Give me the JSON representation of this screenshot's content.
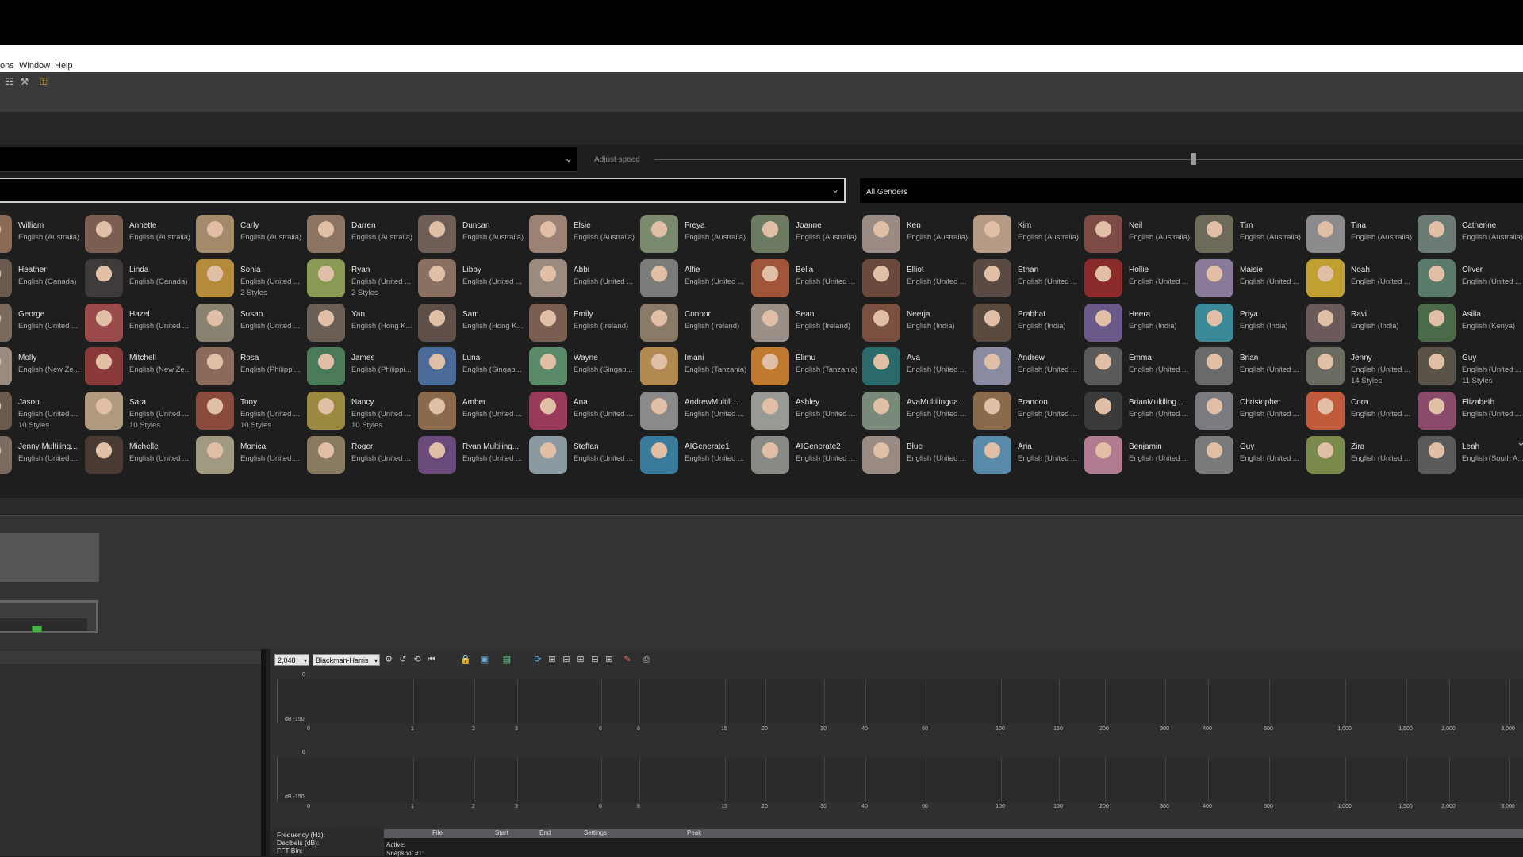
{
  "menu": {
    "items": [
      "ons",
      "Window",
      "Help"
    ]
  },
  "controls": {
    "speed_label": "Adjust speed",
    "speed_fraction": 0.62,
    "gender_filter": "All Genders"
  },
  "voices": [
    [
      {
        "name": "William",
        "sub": "English (Australia)",
        "color": "#8a6a55"
      },
      {
        "name": "Annette",
        "sub": "English (Australia)",
        "color": "#7b5d52"
      },
      {
        "name": "Carly",
        "sub": "English (Australia)",
        "color": "#a38a6a"
      },
      {
        "name": "Darren",
        "sub": "English (Australia)",
        "color": "#8b7462"
      },
      {
        "name": "Duncan",
        "sub": "English (Australia)",
        "color": "#6f5e55"
      },
      {
        "name": "Elsie",
        "sub": "English (Australia)",
        "color": "#9b8274"
      },
      {
        "name": "Freya",
        "sub": "English (Australia)",
        "color": "#7a8a6e"
      },
      {
        "name": "Joanne",
        "sub": "English (Australia)",
        "color": "#6d7a62"
      },
      {
        "name": "Ken",
        "sub": "English (Australia)",
        "color": "#9a8c85"
      },
      {
        "name": "Kim",
        "sub": "English (Australia)",
        "color": "#b59a86"
      },
      {
        "name": "Neil",
        "sub": "English (Australia)",
        "color": "#7c4b45"
      },
      {
        "name": "Tim",
        "sub": "English (Australia)",
        "color": "#6e6a5a"
      },
      {
        "name": "Tina",
        "sub": "English (Australia)",
        "color": "#8c8a8c"
      },
      {
        "name": "Catherine",
        "sub": "English (Australia)",
        "color": "#6b7a72"
      }
    ],
    [
      {
        "name": "Heather",
        "sub": "English (Canada)",
        "color": "#6a5a50"
      },
      {
        "name": "Linda",
        "sub": "English (Canada)",
        "color": "#3e3a3a"
      },
      {
        "name": "Sonia",
        "sub": "English (United ...",
        "styles": "2 Styles",
        "color": "#b58a3a"
      },
      {
        "name": "Ryan",
        "sub": "English (United ...",
        "styles": "2 Styles",
        "color": "#8a9a55"
      },
      {
        "name": "Libby",
        "sub": "English (United ...",
        "color": "#8a7060"
      },
      {
        "name": "Abbi",
        "sub": "English (United ...",
        "color": "#9a8a80"
      },
      {
        "name": "Alfie",
        "sub": "English (United ...",
        "color": "#7a7c7a"
      },
      {
        "name": "Bella",
        "sub": "English (United ...",
        "color": "#a0553a"
      },
      {
        "name": "Elliot",
        "sub": "English (United ...",
        "color": "#6b4a3e"
      },
      {
        "name": "Ethan",
        "sub": "English (United ...",
        "color": "#5a4a44"
      },
      {
        "name": "Hollie",
        "sub": "English (United ...",
        "color": "#8a2a2a"
      },
      {
        "name": "Maisie",
        "sub": "English (United ...",
        "color": "#8a7a9a"
      },
      {
        "name": "Noah",
        "sub": "English (United ...",
        "color": "#c0a030"
      },
      {
        "name": "Oliver",
        "sub": "English (United ...",
        "color": "#5a7a6a"
      }
    ],
    [
      {
        "name": "George",
        "sub": "English (United ...",
        "color": "#7a6a5e"
      },
      {
        "name": "Hazel",
        "sub": "English (United ...",
        "color": "#9a4a4a"
      },
      {
        "name": "Susan",
        "sub": "English (United ...",
        "color": "#8a8270"
      },
      {
        "name": "Yan",
        "sub": "English (Hong K...",
        "color": "#6a5e55"
      },
      {
        "name": "Sam",
        "sub": "English (Hong K...",
        "color": "#5e5048"
      },
      {
        "name": "Emily",
        "sub": "English (Ireland)",
        "color": "#7a5e52"
      },
      {
        "name": "Connor",
        "sub": "English (Ireland)",
        "color": "#8a7a68"
      },
      {
        "name": "Sean",
        "sub": "English (Ireland)",
        "color": "#9a9088"
      },
      {
        "name": "Neerja",
        "sub": "English (India)",
        "color": "#7a5040"
      },
      {
        "name": "Prabhat",
        "sub": "English (India)",
        "color": "#5a4a3e"
      },
      {
        "name": "Heera",
        "sub": "English (India)",
        "color": "#6a5a8a"
      },
      {
        "name": "Priya",
        "sub": "English (India)",
        "color": "#3a8a9a"
      },
      {
        "name": "Ravi",
        "sub": "English (India)",
        "color": "#6a5a5a"
      },
      {
        "name": "Asilia",
        "sub": "English (Kenya)",
        "color": "#4a6a4a"
      }
    ],
    [
      {
        "name": "Molly",
        "sub": "English (New Ze...",
        "color": "#9a8a80"
      },
      {
        "name": "Mitchell",
        "sub": "English (New Ze...",
        "color": "#8a3a3a"
      },
      {
        "name": "Rosa",
        "sub": "English (Philippi...",
        "color": "#8a6a5a"
      },
      {
        "name": "James",
        "sub": "English (Philippi...",
        "color": "#4a7a5a"
      },
      {
        "name": "Luna",
        "sub": "English (Singap...",
        "color": "#4a6a9a"
      },
      {
        "name": "Wayne",
        "sub": "English (Singap...",
        "color": "#5a8a6a"
      },
      {
        "name": "Imani",
        "sub": "English (Tanzania)",
        "color": "#b08a50"
      },
      {
        "name": "Elimu",
        "sub": "English (Tanzania)",
        "color": "#c07a30"
      },
      {
        "name": "Ava",
        "sub": "English (United ...",
        "color": "#2a6a6a"
      },
      {
        "name": "Andrew",
        "sub": "English (United ...",
        "color": "#8a8aa0"
      },
      {
        "name": "Emma",
        "sub": "English (United ...",
        "color": "#5a5a5a"
      },
      {
        "name": "Brian",
        "sub": "English (United ...",
        "color": "#6a6a6a"
      },
      {
        "name": "Jenny",
        "sub": "English (United ...",
        "styles": "14 Styles",
        "color": "#6a6a60"
      },
      {
        "name": "Guy",
        "sub": "English (United ...",
        "styles": "11 Styles",
        "color": "#5a5448"
      }
    ],
    [
      {
        "name": "Jason",
        "sub": "English (United ...",
        "styles": "10 Styles",
        "color": "#6a5a4e"
      },
      {
        "name": "Sara",
        "sub": "English (United ...",
        "styles": "10 Styles",
        "color": "#b09a80"
      },
      {
        "name": "Tony",
        "sub": "English (United ...",
        "styles": "10 Styles",
        "color": "#8a4a3e"
      },
      {
        "name": "Nancy",
        "sub": "English (United ...",
        "styles": "10 Styles",
        "color": "#9a8a40"
      },
      {
        "name": "Amber",
        "sub": "English (United ...",
        "color": "#8a6a4a"
      },
      {
        "name": "Ana",
        "sub": "English (United ...",
        "color": "#9a3a5a"
      },
      {
        "name": "AndrewMultili...",
        "sub": "English (United ...",
        "color": "#8a8a8a"
      },
      {
        "name": "Ashley",
        "sub": "English (United ...",
        "color": "#9a9a94"
      },
      {
        "name": "AvaMultilingua...",
        "sub": "English (United ...",
        "color": "#7a8a7a"
      },
      {
        "name": "Brandon",
        "sub": "English (United ...",
        "color": "#8a6a4a"
      },
      {
        "name": "BrianMultiling...",
        "sub": "English (United ...",
        "color": "#3a3a3a"
      },
      {
        "name": "Christopher",
        "sub": "English (United ...",
        "color": "#7a7a80"
      },
      {
        "name": "Cora",
        "sub": "English (United ...",
        "color": "#c05a3a"
      },
      {
        "name": "Elizabeth",
        "sub": "English (United ...",
        "color": "#8a4a6a"
      }
    ],
    [
      {
        "name": "Jenny Multiling...",
        "sub": "English (United ...",
        "color": "#7a6a60"
      },
      {
        "name": "Michelle",
        "sub": "English (United ...",
        "color": "#4a3a34"
      },
      {
        "name": "Monica",
        "sub": "English (United ...",
        "color": "#a09a80"
      },
      {
        "name": "Roger",
        "sub": "English (United ...",
        "color": "#8a7a60"
      },
      {
        "name": "Ryan Multiling...",
        "sub": "English (United ...",
        "color": "#6a4a7a"
      },
      {
        "name": "Steffan",
        "sub": "English (United ...",
        "color": "#8a9aa0"
      },
      {
        "name": "AIGenerate1",
        "sub": "English (United ...",
        "color": "#3a7a9a"
      },
      {
        "name": "AIGenerate2",
        "sub": "English (United ...",
        "color": "#8a8a84"
      },
      {
        "name": "Blue",
        "sub": "English (United ...",
        "color": "#9a8a84"
      },
      {
        "name": "Aria",
        "sub": "English (United ...",
        "color": "#5a8aaa"
      },
      {
        "name": "Benjamin",
        "sub": "English (United ...",
        "color": "#b07a90"
      },
      {
        "name": "Guy",
        "sub": "English (United ...",
        "color": "#7a7a7a"
      },
      {
        "name": "Zira",
        "sub": "English (United ...",
        "color": "#7a8a4a"
      },
      {
        "name": "Leah",
        "sub": "English (South A...",
        "color": "#5a5a5a"
      }
    ]
  ],
  "analyzer": {
    "fft_size": "2,048",
    "window_fn": "Blackman-Harris",
    "y_top": "0",
    "y_bottom": "dB -150",
    "x_ticks": [
      "0",
      "1",
      "2",
      "3",
      "6",
      "8",
      "15",
      "20",
      "30",
      "40",
      "60",
      "100",
      "150",
      "200",
      "300",
      "400",
      "600",
      "1,000",
      "1,500",
      "2,000",
      "3,000"
    ],
    "readout": {
      "frequency": "Frequency (Hz):",
      "decibels": "Decibels (dB):",
      "fft_bin": "FFT Bin:"
    },
    "snapshot_table": {
      "headers": [
        "File",
        "Start",
        "End",
        "Settings",
        "Peak"
      ],
      "rows": [
        "Active:",
        "Snapshot #1:"
      ]
    }
  }
}
